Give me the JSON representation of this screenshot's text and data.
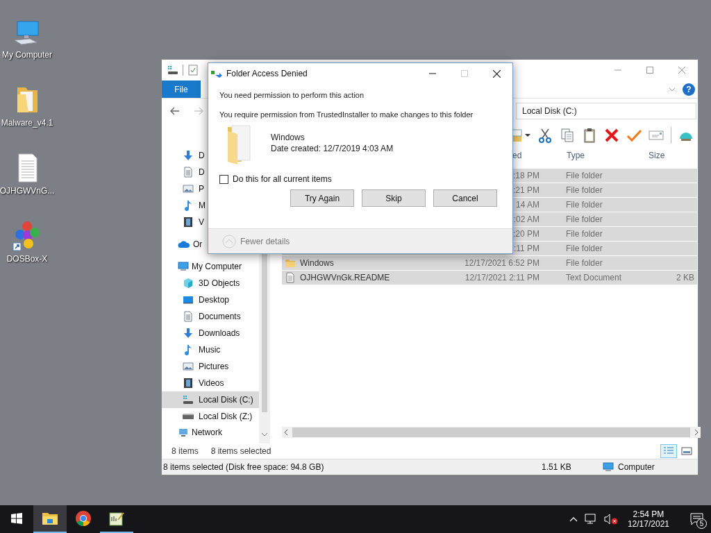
{
  "desktop_icons": [
    {
      "label": "My Computer",
      "kind": "computer"
    },
    {
      "label": "Malware_v4.1",
      "kind": "folder"
    },
    {
      "label": "OJHGWVnG...",
      "kind": "document"
    },
    {
      "label": "DOSBox-X",
      "kind": "app_shortcut"
    }
  ],
  "explorer": {
    "file_tab": "File",
    "help_button": "?",
    "address": "Local Disk (C:)",
    "nav_pane": {
      "partial_items": [
        {
          "label": "D",
          "kind": "downloads"
        },
        {
          "label": "D",
          "kind": "documents"
        },
        {
          "label": "P",
          "kind": "pictures"
        },
        {
          "label": "M",
          "kind": "music"
        },
        {
          "label": "V",
          "kind": "videos"
        }
      ],
      "cloud": {
        "label": "Or"
      },
      "computer": {
        "label": "My Computer",
        "children": [
          {
            "label": "3D Objects",
            "kind": "objects3d",
            "selected": false
          },
          {
            "label": "Desktop",
            "kind": "desktop",
            "selected": false
          },
          {
            "label": "Documents",
            "kind": "documents",
            "selected": false
          },
          {
            "label": "Downloads",
            "kind": "downloads",
            "selected": false
          },
          {
            "label": "Music",
            "kind": "music",
            "selected": false
          },
          {
            "label": "Pictures",
            "kind": "pictures",
            "selected": false
          },
          {
            "label": "Videos",
            "kind": "videos",
            "selected": false
          },
          {
            "label": "Local Disk (C:)",
            "kind": "drive_sys",
            "selected": true
          },
          {
            "label": "Local Disk (Z:)",
            "kind": "drive",
            "selected": false
          }
        ]
      },
      "network": {
        "label": "Network"
      }
    },
    "columns": [
      "ed",
      "Type",
      "Size"
    ],
    "rows": [
      {
        "date": ":18 PM",
        "type": "File folder",
        "selected": true
      },
      {
        "date": ":21 PM",
        "type": "File folder",
        "selected": true
      },
      {
        "date": "14 AM",
        "type": "File folder",
        "selected": true
      },
      {
        "date": ":02 AM",
        "type": "File folder",
        "selected": true
      },
      {
        "date": ":20 PM",
        "type": "File folder",
        "selected": true
      },
      {
        "date": ":11 PM",
        "type": "File folder",
        "selected": true
      },
      {
        "name": "Windows",
        "kind": "folder",
        "date": "12/17/2021 6:52 PM",
        "type": "File folder",
        "selected": true
      },
      {
        "name": "OJHGWVnGk.README",
        "kind": "document",
        "date": "12/17/2021 2:11 PM",
        "type": "Text Document",
        "size": "2 KB",
        "selected": true
      }
    ],
    "item_count": "8 items",
    "selected_count": "8 items selected",
    "view_buttons": [
      {
        "kind": "details",
        "selected": true
      },
      {
        "kind": "large_icons",
        "selected": false
      }
    ],
    "status_bar": {
      "summary": "8 items selected (Disk free space: 94.8 GB)",
      "size": "1.51 KB",
      "location": "Computer"
    }
  },
  "dialog": {
    "title": "Folder Access Denied",
    "heading": "You need permission to perform this action",
    "message": "You require permission from TrustedInstaller to make changes to this folder",
    "item": {
      "name": "Windows",
      "date_created": "Date created: 12/7/2019 4:03 AM"
    },
    "apply_all": {
      "label": "Do this for all current items",
      "checked": false
    },
    "buttons": [
      "Try Again",
      "Skip",
      "Cancel"
    ],
    "details_toggle": "Fewer details"
  },
  "taskbar": {
    "apps": [
      {
        "kind": "explorer",
        "selected": true,
        "running": true
      },
      {
        "kind": "browser",
        "selected": false,
        "running": false
      },
      {
        "kind": "notepad",
        "selected": false,
        "running": true
      }
    ],
    "tray": {
      "time": "2:54 PM",
      "date": "12/17/2021",
      "notification_count": "5",
      "volume_muted": true
    }
  }
}
